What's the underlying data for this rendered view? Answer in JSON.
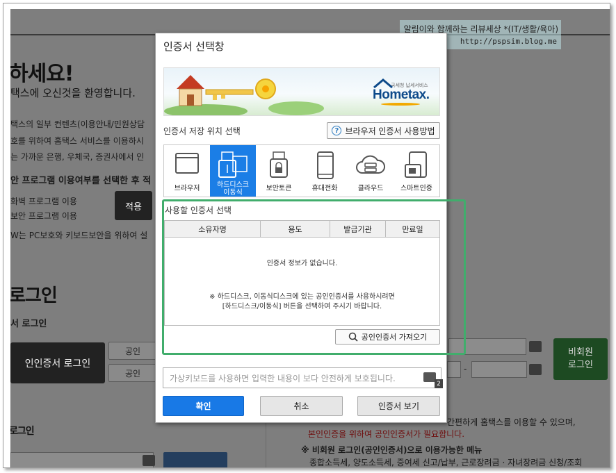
{
  "watermark": {
    "line1": "알림이와 함께하는 리뷰세상 *(IT/생활/육아)",
    "line2": "http://pspsim.blog.me"
  },
  "background": {
    "greeting": "하세요!",
    "welcome": "택스에 오신것을 환영합니다.",
    "info1": "택스의 일부 컨텐츠(이용안내/민원상담",
    "info2": "호를 위하여 홈택스 서비스를 이용하시",
    "info3": "는 가까운 은행, 우체국, 증권사에서 인",
    "program_select": "안 프로그램 이용여부를 선택한 후 적",
    "opt1": "화벽 프로그램 이용",
    "opt2": "보안 프로그램 이용",
    "apply": "적용",
    "pc_note": "W는 PC보호와 키보드보안을 위하여 설",
    "login_heading": "로그인",
    "cert_login_sub": "서 로그인",
    "cert_login_btn": "인인증서 로그인",
    "pub_btn1": "공인",
    "pub_btn2": "공인",
    "login_heading2": "로그인",
    "nonmember_btn": "비회원\n로그인",
    "dash": "-",
    "right1": "간편하게 홈택스를 이용할 수 있으며,",
    "right2": "본인인증을 위하여 공인인증서가 필요합니다.",
    "right3": "※ 비회원 로그인(공인인증서)으로 이용가능한 메뉴",
    "right4": "종합소득세, 양도소득세, 증여세 신고/납부, 근로장려금 · 자녀장려금 신청/조회"
  },
  "dialog": {
    "title": "인증서 선택창",
    "banner": {
      "brand": "Hometax.",
      "brand_sub": "국세청 납세서비스"
    },
    "storage_label": "인증서 저장 위치 선택",
    "help_button": "브라우저 인증서 사용방법",
    "locations": [
      {
        "label": "브라우저",
        "icon": "browser-icon",
        "active": false
      },
      {
        "label": "하드디스크\n이동식",
        "icon": "usb-drive-icon",
        "active": true
      },
      {
        "label": "보안토큰",
        "icon": "security-token-icon",
        "active": false
      },
      {
        "label": "휴대전화",
        "icon": "mobile-phone-icon",
        "active": false
      },
      {
        "label": "클라우드",
        "icon": "cloud-icon",
        "active": false
      },
      {
        "label": "스마트인증",
        "icon": "smart-auth-icon",
        "active": false
      }
    ],
    "cert_select_label": "사용할 인증서 선택",
    "columns": [
      "소유자명",
      "용도",
      "발급기관",
      "만료일"
    ],
    "empty_message": "인증서 정보가 없습니다.",
    "notice_line1": "※ 하드디스크, 이동식디스크에 있는 공인인증서를 사용하시려면",
    "notice_line2": "[하드디스크/이동식] 버튼을 선택하여 주시기 바랍니다.",
    "import_button": "공인인증서 가져오기",
    "password_placeholder": "가상키보드를 사용하면 입력한 내용이 보다 안전하게 보호됩니다.",
    "vk_badge": "2",
    "buttons": {
      "ok": "확인",
      "cancel": "취소",
      "view": "인증서 보기"
    },
    "accent_color": "#1879e6",
    "highlight_color": "#41ad6c"
  }
}
